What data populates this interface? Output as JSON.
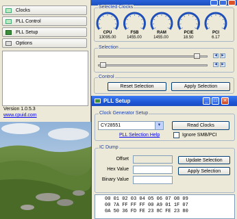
{
  "left_window": {
    "nav": [
      {
        "label": "Clocks"
      },
      {
        "label": "PLL Control"
      },
      {
        "label": "PLL Setup"
      },
      {
        "label": "Options"
      }
    ],
    "version": "Version 1.0.5.3",
    "url": "www.cpuid.com"
  },
  "clocks_window": {
    "selected_clocks_label": "Selected Clocks",
    "gauges": [
      {
        "name": "CPU",
        "value": "13095.00"
      },
      {
        "name": "FSB",
        "value": "1455.00"
      },
      {
        "name": "RAM",
        "value": "1455.00"
      },
      {
        "name": "PCIE",
        "value": "18.50"
      },
      {
        "name": "PCI",
        "value": "6.17"
      }
    ],
    "selection_label": "Selection",
    "slider1_level": 0.93,
    "slider2_level": 0.02,
    "control_label": "Control",
    "reset_label": "Reset Selection",
    "apply_label": "Apply Selection"
  },
  "pll_window": {
    "title": "PLL Setup",
    "clock_gen_label": "Clock Generator Setup",
    "clock_gen_value": "CY28551",
    "read_clocks_label": "Read Clocks",
    "pll_help_link": "PLL Selection Help",
    "ignore_label": "Ignore SMB/PCI",
    "ic_dump_label": "IC Dump",
    "offset_label": "Offset",
    "hex_label": "Hex Value",
    "binary_label": "Binary Value",
    "update_label": "Update Selection",
    "apply_label": "Apply Selection",
    "dump_lines": [
      "00 01 02 03 04 05 06 07 08 09",
      "00 7A FF FF FF 00 A9 01 1F 07",
      "0A 50 36 FD FE 23 8C FE 23 80"
    ]
  },
  "colors": {
    "titlebar": "#1f57d5",
    "group_text": "#1b3fa5",
    "gauge": "#1f4fb8"
  }
}
